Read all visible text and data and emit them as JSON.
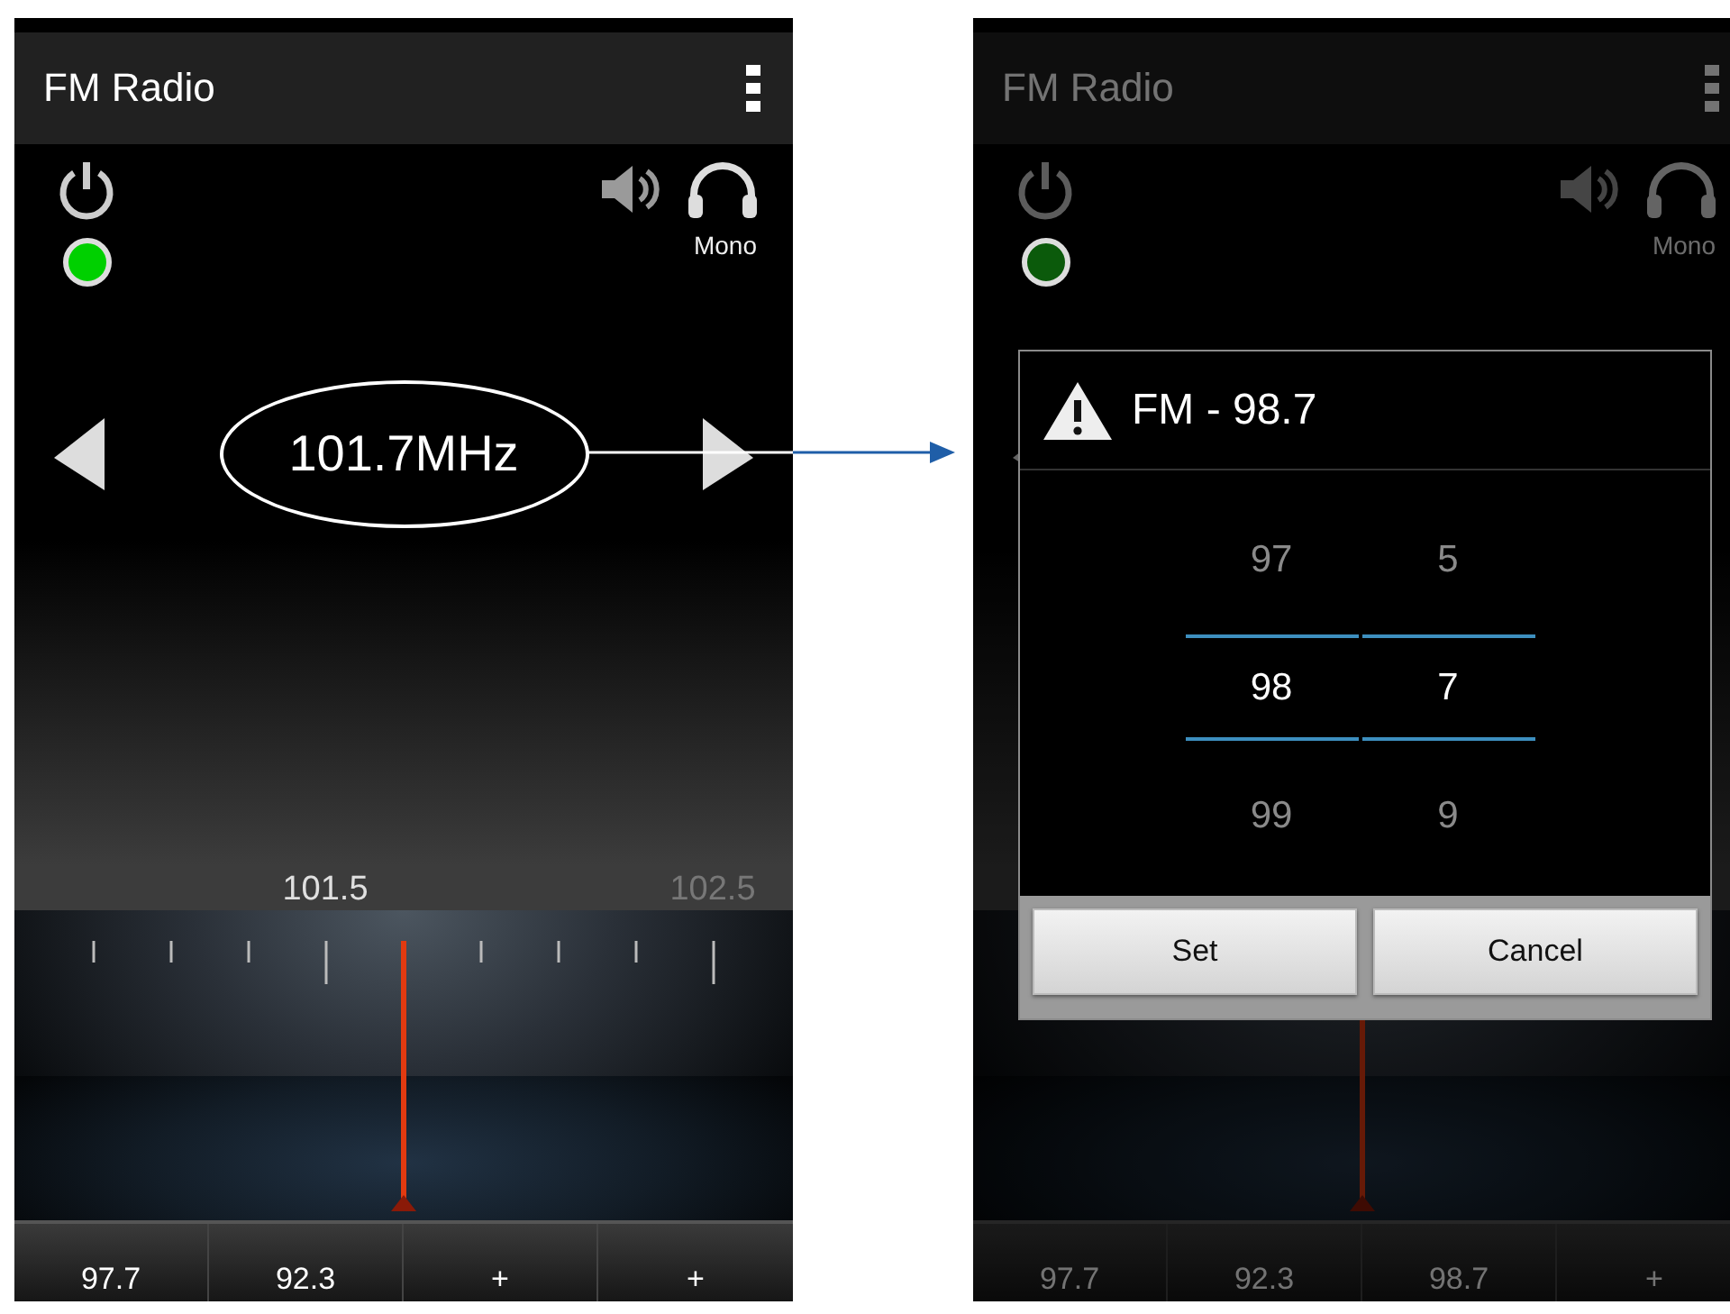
{
  "screens": [
    {
      "title": "FM Radio",
      "led": {
        "color": "#00d000"
      },
      "audio_mode": "Mono",
      "frequency": "101.7MHz",
      "scale_labels": [
        {
          "text": "101.5",
          "selected": true
        },
        {
          "text": "102.5",
          "selected": false
        }
      ],
      "presets": [
        "97.7",
        "92.3",
        "+",
        "+"
      ],
      "dimmed": false
    },
    {
      "title": "FM Radio",
      "led": {
        "color": "#0b5a0b"
      },
      "audio_mode": "Mono",
      "presets": [
        "97.7",
        "92.3",
        "98.7",
        "+"
      ],
      "dimmed": true,
      "dialog": {
        "title": "FM - 98.7",
        "picker": [
          {
            "values": [
              {
                "text": "97",
                "selected": false
              },
              {
                "text": "98",
                "selected": true
              },
              {
                "text": "99",
                "selected": false
              }
            ]
          },
          {
            "values": [
              {
                "text": "5",
                "selected": false
              },
              {
                "text": "7",
                "selected": true
              },
              {
                "text": "9",
                "selected": false
              }
            ]
          }
        ],
        "buttons": [
          "Set",
          "Cancel"
        ]
      }
    }
  ]
}
